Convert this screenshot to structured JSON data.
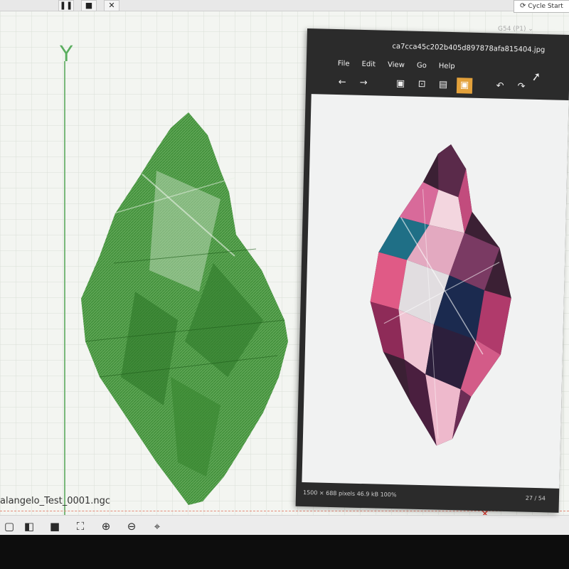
{
  "viewer": {
    "axis_label": "Y",
    "file_name": "alangelo_Test_0001.ngc",
    "cycle_start_label": "Cycle Start",
    "wcs_select": "G54 (P1)",
    "top_toolbar_icons": [
      "pause-icon",
      "stop-icon",
      "close-icon"
    ],
    "bottom_toolbar_icons": [
      "cube-front-icon",
      "cube-iso-icon",
      "cube-solid-icon",
      "fit-view-icon",
      "zoom-in-icon",
      "zoom-out-icon",
      "crosshair-icon"
    ],
    "toolpath_color": "#3f8f36"
  },
  "image_viewer": {
    "title": "ca7cca45c202b405d897878afa815404.jpg",
    "menu": [
      "File",
      "Edit",
      "View",
      "Go",
      "Help"
    ],
    "toolbar_icons": [
      "back-icon",
      "forward-icon",
      "page-icon",
      "zoom-fit-icon",
      "zoom-original-icon",
      "fullscreen-icon",
      "rotate-left-icon",
      "rotate-right-icon"
    ],
    "status_left": "1500 × 688 pixels  46.9 kB  100%",
    "status_right": "27 / 54",
    "accent": "#e3a13b"
  }
}
